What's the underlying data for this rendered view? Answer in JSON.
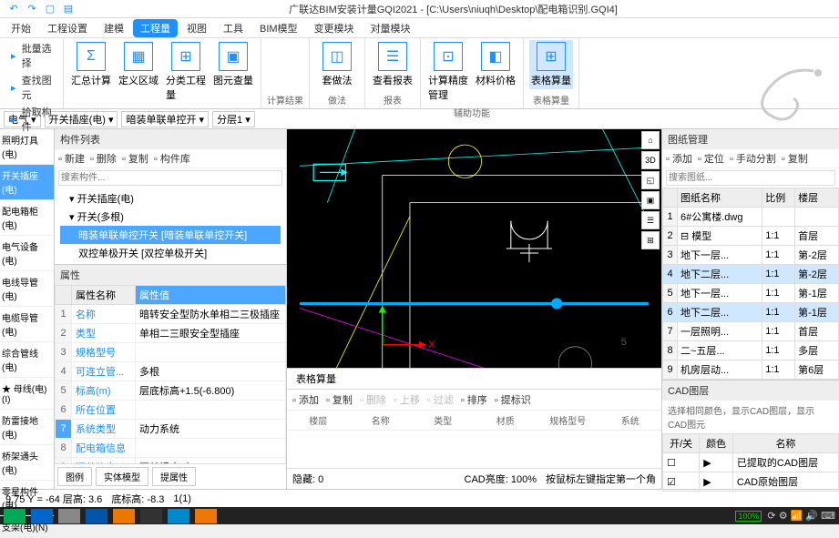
{
  "title": "广联达BIM安装计量GQI2021 - [C:\\Users\\niuqh\\Desktop\\配电箱识别.GQI4]",
  "qat": [
    "←",
    "→",
    "□",
    "▤"
  ],
  "menu": [
    "开始",
    "工程设置",
    "建模",
    "工程量",
    "视图",
    "工具",
    "BIM模型",
    "变更模块",
    "对量模块"
  ],
  "menu_active": 3,
  "ribbon_left": [
    "批量选择",
    "查找图元",
    "拾取构件"
  ],
  "ribbon_groups": [
    {
      "label": "",
      "big": [
        {
          "t": "汇总计算",
          "i": "Σ"
        },
        {
          "t": "定义区域",
          "i": "▦"
        },
        {
          "t": "分类工程量",
          "i": "⊞"
        },
        {
          "t": "图元查量",
          "i": "▣"
        }
      ]
    },
    {
      "label": "计算结果"
    },
    {
      "label": "做法",
      "big": [
        {
          "t": "套做法",
          "i": "◫"
        }
      ]
    },
    {
      "label": "报表",
      "big": [
        {
          "t": "查看报表",
          "i": "☰"
        }
      ]
    },
    {
      "label": "辅助功能",
      "big": [
        {
          "t": "计算精度管理",
          "i": "⊡"
        },
        {
          "t": "材料价格",
          "i": "◧"
        }
      ]
    },
    {
      "label": "表格算量",
      "big": [
        {
          "t": "表格算量",
          "i": "⊞",
          "active": true
        }
      ]
    }
  ],
  "filters": [
    "电气",
    "开关插座(电)",
    "暗装单联单控开",
    "分层1"
  ],
  "left_items": [
    "照明灯具(电)",
    "开关插座(电)",
    "配电箱柜(电)",
    "电气设备(电)",
    "电线导管(电)",
    "电缆导管(电)",
    "综合管线(电)",
    "★ 母线(电)(I)",
    "防雷接地(电)",
    "桥架通头(电)",
    "零星构件(电)",
    "支架(电)(N)"
  ],
  "left_sel": 1,
  "comp": {
    "hdr": "构件列表",
    "tb": [
      "新建",
      "删除",
      "复制",
      "构件库"
    ],
    "search_ph": "搜索构件...",
    "tree": [
      {
        "t": "开关插座(电)",
        "l": 0
      },
      {
        "t": "开关(多根)",
        "l": 1
      },
      {
        "t": "暗装单联单控开关 [暗装单联单控开关]",
        "l": 2,
        "sel": true
      },
      {
        "t": "双控单极开关 [双控单极开关]",
        "l": 2
      }
    ]
  },
  "props": {
    "hdr": "属性",
    "cols": [
      "属性名称",
      "属性值"
    ],
    "rows": [
      [
        "1",
        "名称",
        "暗转安全型防水单相二三极插座"
      ],
      [
        "2",
        "类型",
        "单相二三眼安全型插座"
      ],
      [
        "3",
        "规格型号",
        ""
      ],
      [
        "4",
        "可连立管...",
        "多根"
      ],
      [
        "5",
        "标高(m)",
        "层底标高+1.5(-6.800)"
      ],
      [
        "6",
        "所在位置",
        ""
      ],
      [
        "7",
        "系统类型",
        "动力系统"
      ],
      [
        "8",
        "配电箱信息",
        ""
      ],
      [
        "9",
        "汇总信息",
        "开关插座(电)"
      ]
    ],
    "sel": 6,
    "btns": [
      "图例",
      "实体模型",
      "提属性"
    ]
  },
  "bottom": {
    "tab": "表格算量",
    "tb": [
      "添加",
      "复制",
      "删除",
      "上移",
      "过滤",
      "排序",
      "提标识"
    ],
    "cols": [
      "楼层",
      "名称",
      "类型",
      "材质",
      "规格型号",
      "系统"
    ],
    "footer_l": "隐藏: 0",
    "footer_vals": [
      "",
      "",
      "",
      "",
      "CAD亮度: 100%",
      "按鼠标左键指定第一个角"
    ]
  },
  "right": {
    "hdr": "图纸管理",
    "tb": [
      "添加",
      "定位",
      "手动分割",
      "复制"
    ],
    "search_ph": "搜索图纸...",
    "cols": [
      "图纸名称",
      "比例",
      "楼层"
    ],
    "rows": [
      [
        "1",
        "6#公寓楼.dwg",
        "",
        ""
      ],
      [
        "2",
        "⊟ 模型",
        "1:1",
        "首层"
      ],
      [
        "3",
        "地下一层...",
        "1:1",
        "第-2层"
      ],
      [
        "4",
        "地下二层...",
        "1:1",
        "第-2层"
      ],
      [
        "5",
        "地下一层...",
        "1:1",
        "第-1层"
      ],
      [
        "6",
        "地下二层...",
        "1:1",
        "第-1层"
      ],
      [
        "7",
        "一层照明...",
        "1:1",
        "首层"
      ],
      [
        "8",
        "二~五层...",
        "1:1",
        "多层"
      ],
      [
        "9",
        "机房层动...",
        "1:1",
        "第6层"
      ]
    ],
    "sel": [
      3,
      5
    ],
    "cad_hdr": "CAD图层",
    "cad_desc": "选择相同颜色，显示CAD图层，显示CAD图元",
    "cad_cols": [
      "开/关",
      "颜色",
      "名称"
    ],
    "cad_rows": [
      [
        "☐",
        "▶",
        "已提取的CAD图层"
      ],
      [
        "☑",
        "▶",
        "CAD原始图层"
      ]
    ]
  },
  "status": {
    "coords": "9.75 Y = -64 层高: 3.6",
    "bh": "底标高: -8.3",
    "n": "1(1)"
  },
  "battery": "100%"
}
